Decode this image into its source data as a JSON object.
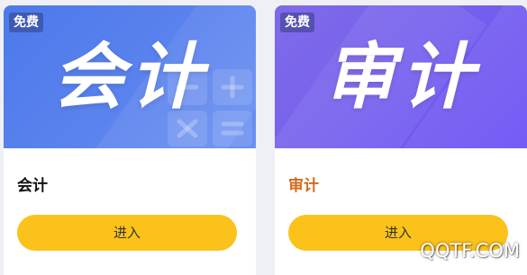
{
  "cards": [
    {
      "badge": "免费",
      "banner_text": "会计",
      "title": "会计",
      "button_label": "进入",
      "gradient": [
        "#4d79ea",
        "#6a8ff1"
      ]
    },
    {
      "badge": "免费",
      "banner_text": "审计",
      "title": "审计",
      "title_color": "#d26a1e",
      "button_label": "进入",
      "gradient": [
        "#7f6be8",
        "#6b4ff6"
      ]
    }
  ],
  "button_color": "#fbc21b",
  "watermark": "QQTF.COM"
}
